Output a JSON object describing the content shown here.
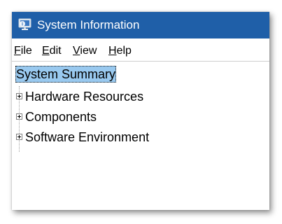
{
  "window": {
    "title": "System Information",
    "icon": "system-information-icon",
    "titlebar_color": "#1f5fa8"
  },
  "menu": {
    "items": [
      {
        "mnemonic": "F",
        "rest": "ile"
      },
      {
        "mnemonic": "E",
        "rest": "dit"
      },
      {
        "mnemonic": "V",
        "rest": "iew"
      },
      {
        "mnemonic": "H",
        "rest": "elp"
      }
    ]
  },
  "tree": {
    "root": {
      "label": "System Summary",
      "selected": true,
      "highlight_color": "#99c9ef"
    },
    "children": [
      {
        "label": "Hardware Resources",
        "expander": "plus-icon"
      },
      {
        "label": "Components",
        "expander": "plus-icon"
      },
      {
        "label": "Software Environment",
        "expander": "plus-icon"
      }
    ]
  }
}
